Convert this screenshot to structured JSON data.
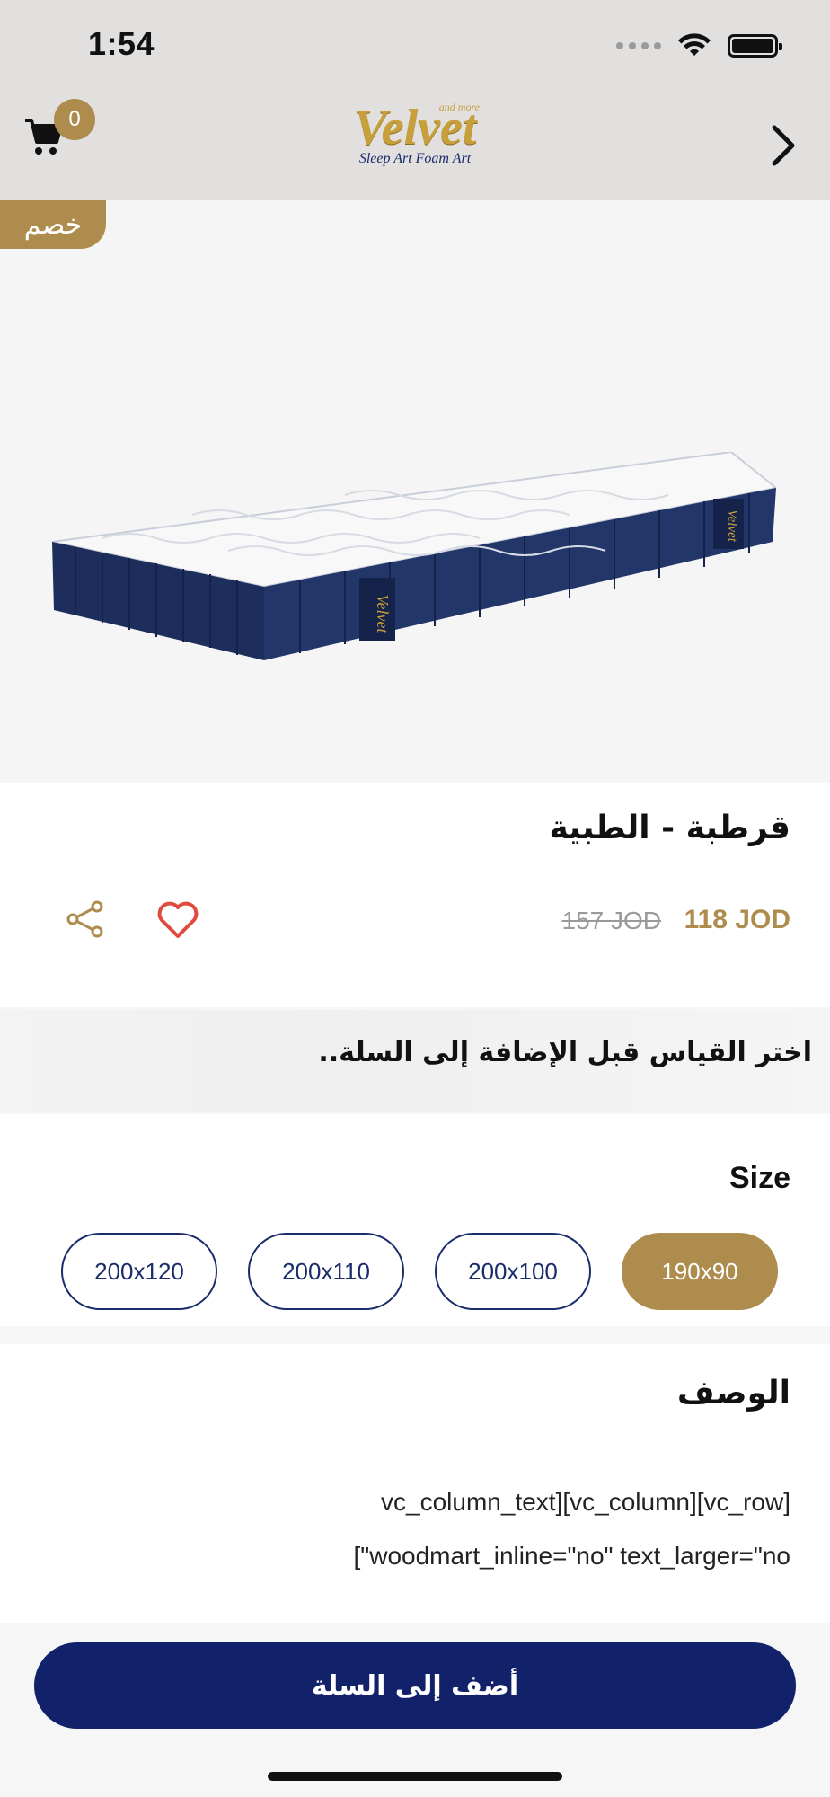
{
  "status_bar": {
    "time": "1:54",
    "icons": [
      "cellular-dots",
      "wifi-icon",
      "battery-icon"
    ]
  },
  "header": {
    "cart_count": "0",
    "logo": {
      "main": "Velvet",
      "top": "and more",
      "sub": "Sleep Art Foam Art"
    },
    "nav_icon": "chevron-right-icon"
  },
  "product": {
    "discount_badge": "خصم",
    "title": "قرطبة - الطبية",
    "price_current": "118 JOD",
    "price_old": "157 JOD",
    "actions": [
      "favorite-heart-icon",
      "share-icon"
    ]
  },
  "notice": {
    "text": "اختر القياس قبل الإضافة إلى السلة.."
  },
  "sizes": {
    "label": "Size",
    "options": [
      "190x90",
      "200x100",
      "200x110",
      "200x120"
    ],
    "selected": "190x90"
  },
  "description": {
    "title": "الوصف",
    "lines": [
      "vc_column_text][vc_column][vc_row]",
      "[\"woodmart_inline=\"no\" text_larger=\"no"
    ]
  },
  "cta": {
    "label": "أضف إلى السلة"
  },
  "colors": {
    "accent": "#ad8c4e",
    "primary": "#12226a",
    "heart": "#e04b3f"
  }
}
